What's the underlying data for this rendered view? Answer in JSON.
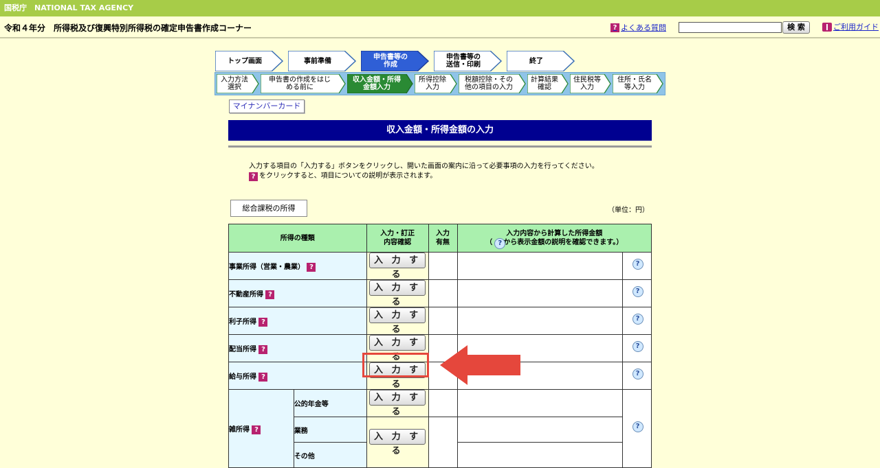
{
  "agency": "国税庁　NATIONAL TAX AGENCY",
  "page_title": "令和４年分　所得税及び復興特別所得税の確定申告書作成コーナー",
  "header": {
    "faq_label": "よくある質問",
    "search_value": "",
    "search_button": "検 索",
    "guide_label": "ご利用ガイド"
  },
  "steps": [
    {
      "label": "トップ画面",
      "state": "done"
    },
    {
      "label": "事前準備",
      "state": "done"
    },
    {
      "label": "申告書等の\n作成",
      "state": "current"
    },
    {
      "label": "申告書等の\n送信・印刷",
      "state": "todo"
    },
    {
      "label": "終了",
      "state": "todo"
    }
  ],
  "substeps": [
    {
      "label": "入力方法\n選択",
      "state": "done"
    },
    {
      "label": "申告書の作成をはじ\nめる前に",
      "state": "done"
    },
    {
      "label": "収入金額・所得\n金額入力",
      "state": "current"
    },
    {
      "label": "所得控除\n入力",
      "state": "todo"
    },
    {
      "label": "税額控除・その\n他の項目の入力",
      "state": "todo"
    },
    {
      "label": "計算結果\n確認",
      "state": "todo"
    },
    {
      "label": "住民税等\n入力",
      "state": "todo"
    },
    {
      "label": "住所・氏名\n等入力",
      "state": "todo"
    }
  ],
  "mynumber_button": "マイナンバーカード",
  "section_title": "収入金額・所得金額の入力",
  "instructions": {
    "line1": "入力する項目の「入力する」ボタンをクリックし、開いた画面の案内に沿って必要事項の入力を行ってください。",
    "line2": "をクリックすると、項目についての説明が表示されます。"
  },
  "tab_label": "総合課税の所得",
  "unit_label": "（単位：円）",
  "table": {
    "headers": {
      "type": "所得の種類",
      "confirm": "入力・訂正\n内容確認",
      "status": "入力\n有無",
      "amount_line1": "入力内容から計算した所得金額",
      "amount_line2_pre": "（",
      "amount_line2_post": "から表示金額の説明を確認できます。）"
    },
    "input_button": "入 力 す る",
    "rows": [
      {
        "label": "事業所得（営業・農業）"
      },
      {
        "label": "不動産所得"
      },
      {
        "label": "利子所得"
      },
      {
        "label": "配当所得"
      },
      {
        "label": "給与所得"
      }
    ],
    "misc": {
      "label": "雑所得",
      "sub": [
        "公的年金等",
        "業務",
        "その他"
      ]
    }
  },
  "colors": {
    "agency_bar": "#A7CC48",
    "background": "#FFFFD9",
    "section_header": "#000090",
    "table_header": "#AAF0AE",
    "highlight": "#E5473C"
  }
}
